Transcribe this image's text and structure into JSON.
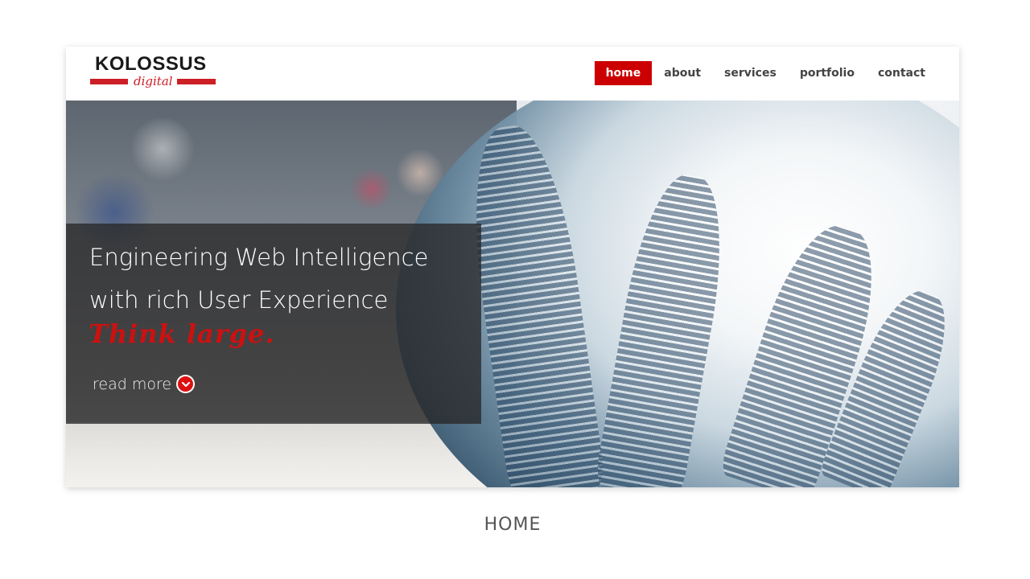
{
  "brand": {
    "logo_word": "KOLOSSUS",
    "logo_sub": "digital",
    "accent_color": "#cc0000"
  },
  "nav": {
    "items": [
      {
        "label": "home",
        "active": true
      },
      {
        "label": "about",
        "active": false
      },
      {
        "label": "services",
        "active": false
      },
      {
        "label": "portfolio",
        "active": false
      },
      {
        "label": "contact",
        "active": false
      }
    ]
  },
  "hero": {
    "headline_line1": "Engineering Web Intelligence",
    "headline_line2": "with rich User Experience",
    "tagline": "Think large.",
    "read_more_label": "read more",
    "read_more_icon": "chevron-down-circle-icon"
  },
  "caption": "HOME"
}
